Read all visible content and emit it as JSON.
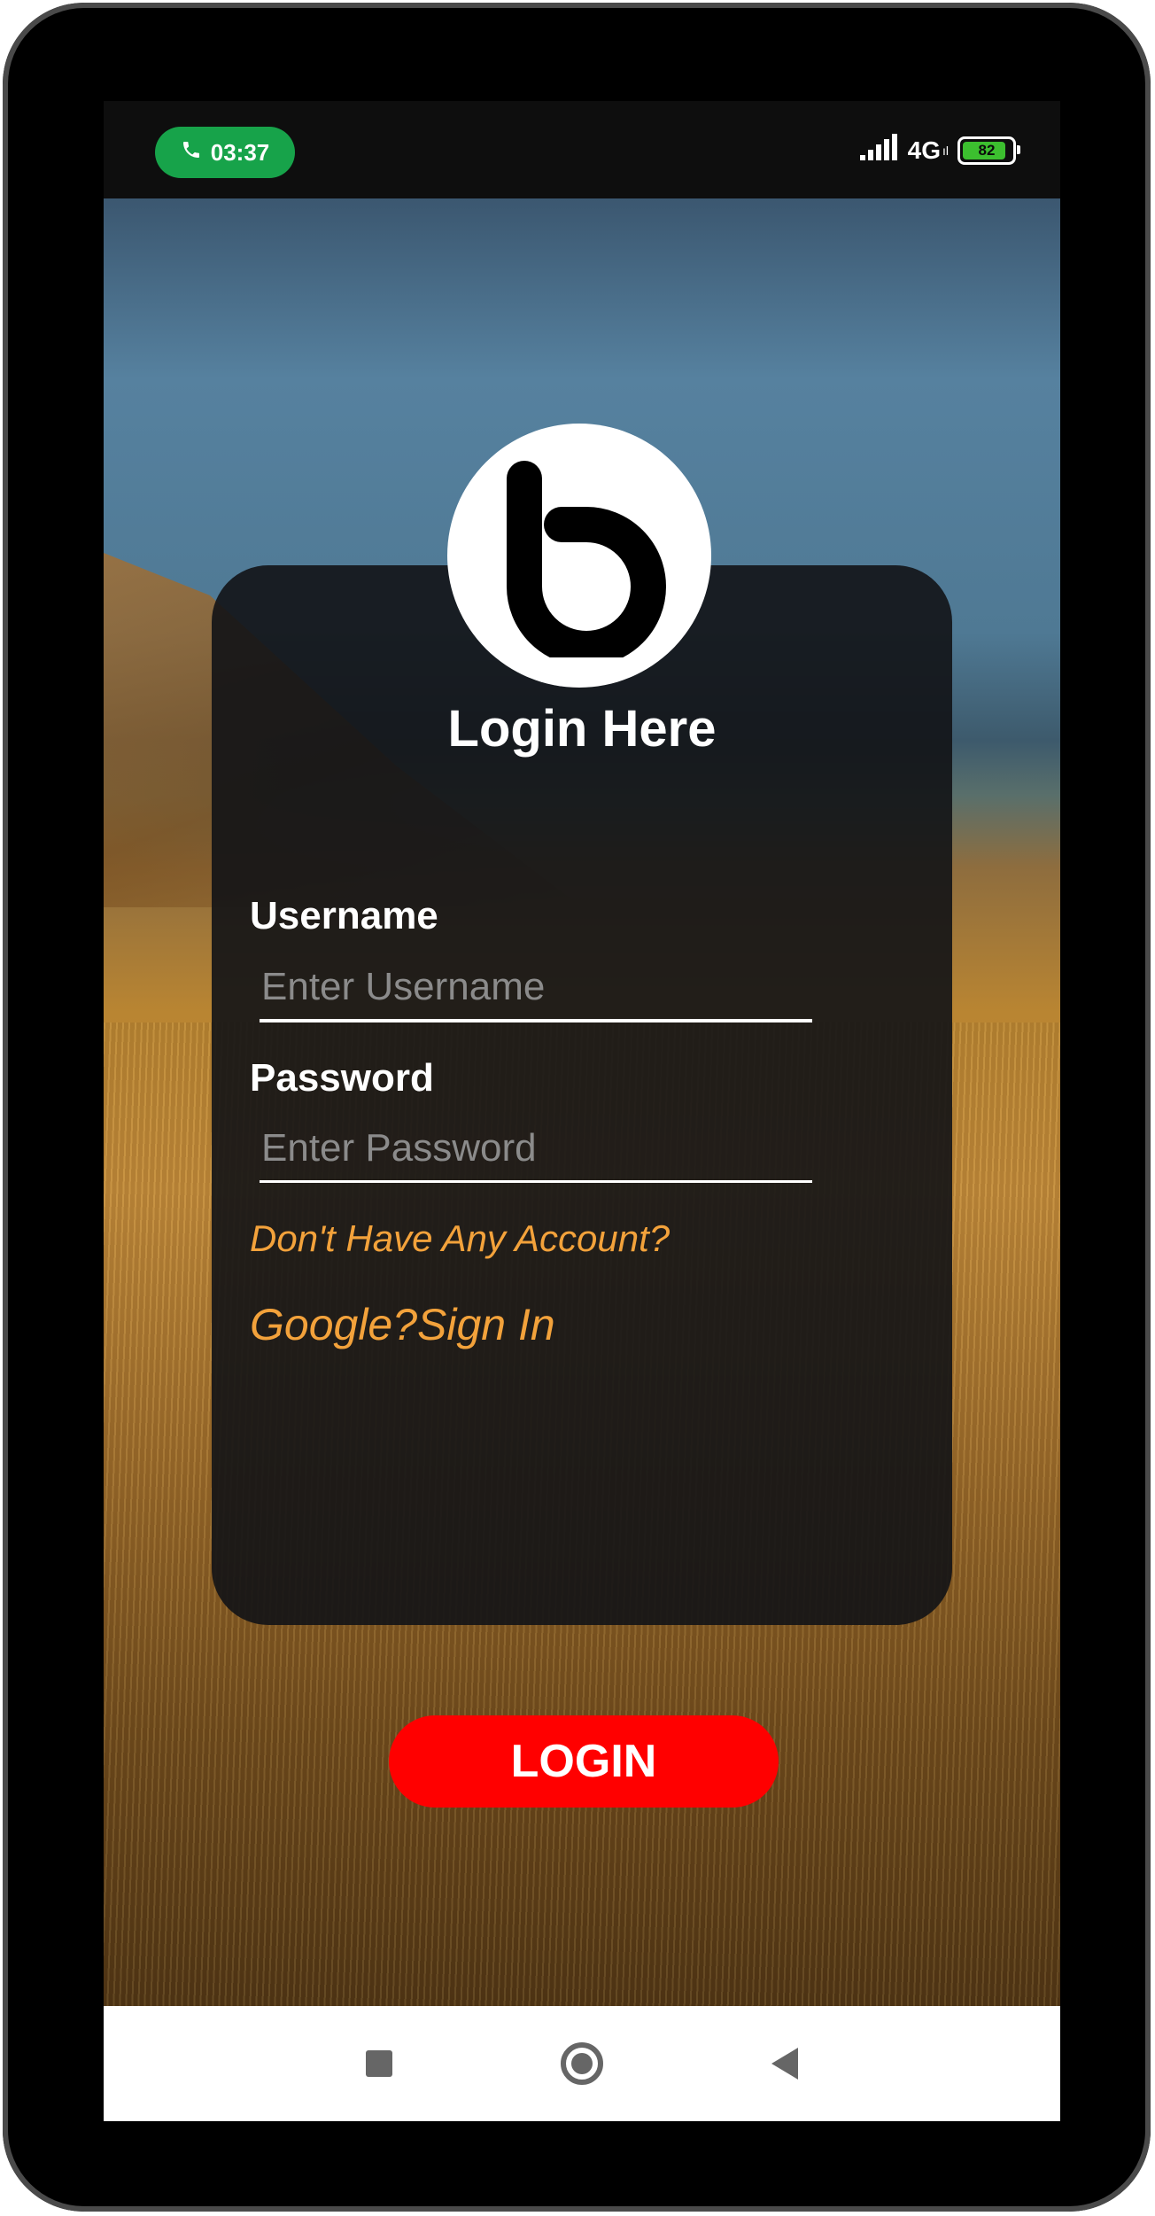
{
  "status_bar": {
    "call_time": "03:37",
    "network": "4G",
    "network_sub": "ıl",
    "battery": "82"
  },
  "login": {
    "title": "Login Here",
    "username_label": "Username",
    "username_placeholder": "Enter Username",
    "password_label": "Password",
    "password_placeholder": "Enter Password",
    "signup_link": "Don't Have Any Account?",
    "google_link": "Google?Sign In",
    "login_button": "LOGIN"
  },
  "colors": {
    "accent_link": "#f3a23b",
    "login_button": "#ff0000",
    "call_pill": "#17a34a"
  },
  "icons": [
    "phone-icon",
    "signal-icon",
    "battery-icon",
    "app-logo-icon",
    "nav-recents-icon",
    "nav-home-icon",
    "nav-back-icon"
  ]
}
